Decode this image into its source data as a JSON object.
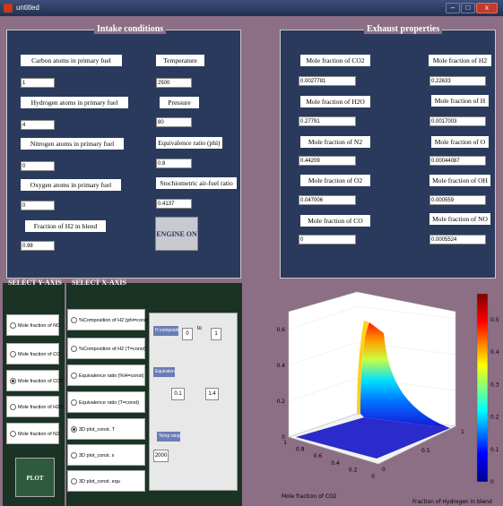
{
  "window": {
    "title": "untitled",
    "minimize": "–",
    "maximize": "□",
    "close": "x"
  },
  "intake": {
    "title": "Intake conditions",
    "fields": [
      {
        "label": "Carbon atoms in primary fuel",
        "value": "1"
      },
      {
        "label": "Hydrogen atoms in primary fuel",
        "value": "4"
      },
      {
        "label": "Nitrogen atoms in primary fuel",
        "value": "0"
      },
      {
        "label": "Oxygen atoms in primary fuel",
        "value": "0"
      },
      {
        "label": "Fraction of H2 in blend",
        "value": "0.98"
      }
    ],
    "right_fields": [
      {
        "label": "Temperature",
        "value": "2500"
      },
      {
        "label": "Pressure",
        "value": "80"
      },
      {
        "label": "Equivalence ratio (phi)",
        "value": "0.8"
      },
      {
        "label": "Stochiometric air-fuel ratio",
        "value": "0.4137"
      }
    ],
    "engine_button": "ENGINE ON"
  },
  "exhaust": {
    "title": "Exhaust properties",
    "left": [
      {
        "label": "Mole fraction of CO2",
        "value": "0.0027781"
      },
      {
        "label": "Mole fraction of H2O",
        "value": "0.27791"
      },
      {
        "label": "Mole fraction of N2",
        "value": "0.44209"
      },
      {
        "label": "Mole fraction of O2",
        "value": "0.047006"
      },
      {
        "label": "Mole fraction of CO",
        "value": "0"
      }
    ],
    "right": [
      {
        "label": "Mole fraction of H2",
        "value": "0.22633"
      },
      {
        "label": "Mole fraction of H",
        "value": "0.0017003"
      },
      {
        "label": "Mole fraction of O",
        "value": "0.00044087"
      },
      {
        "label": "Mole fraction of OH",
        "value": "0.000559"
      },
      {
        "label": "Mole fraction of NO",
        "value": "0.0005524"
      }
    ]
  },
  "yaxis": {
    "title": "SELECT Y-AXIS",
    "options": [
      {
        "label": "Mole fraction of NO",
        "selected": false
      },
      {
        "label": "Mole fraction of CO",
        "selected": false
      },
      {
        "label": "Mole fraction of CO2",
        "selected": true
      },
      {
        "label": "Mole fraction of H2O",
        "selected": false
      },
      {
        "label": "Mole fraction of N2",
        "selected": false
      }
    ],
    "plot_button": "PLOT GRAPH"
  },
  "xaxis": {
    "title": "SELECT X-AXIS",
    "options": [
      {
        "label": "%Composition of H2 (phi=const)",
        "selected": false
      },
      {
        "label": "%Composition of H2 (T=const)",
        "selected": false
      },
      {
        "label": "Equivalence ratio (%H=const)",
        "selected": false
      },
      {
        "label": "Equivalence ratio (T=const)",
        "selected": false
      },
      {
        "label": "3D plot_const. T",
        "selected": true
      },
      {
        "label": "3D plot_const. x",
        "selected": false
      },
      {
        "label": "3D plot_const. equ",
        "selected": false
      }
    ]
  },
  "ranges": {
    "h_composition_label": "H composition",
    "h_from": "0",
    "to_label": "to",
    "h_to": "1",
    "equivalence_label": "Equivalence",
    "eq_from": "0.1",
    "eq_to": "1.4",
    "temp_label": "Temp range",
    "temp_value": "2000"
  },
  "chart_data": {
    "type": "surface",
    "xlabel": "Fraction of Hydrogen in blend",
    "ylabel": "Mole fraction of CO2",
    "zticks": [
      "0",
      "0.2",
      "0.4",
      "0.6"
    ],
    "xticks": [
      "0",
      "0.5",
      "1"
    ],
    "yticks": [
      "0",
      "0.2",
      "0.4",
      "0.6",
      "0.8",
      "1"
    ],
    "zlim": [
      0,
      0.6
    ],
    "colorbar_ticks": [
      "0",
      "0.1",
      "0.2",
      "0.3",
      "0.4",
      "0.5"
    ],
    "colorbar_range": [
      0,
      0.58
    ],
    "peak_value": 0.55,
    "colormap": [
      "#00008f",
      "#0000ff",
      "#00ffff",
      "#ffff00",
      "#ff0000",
      "#800000"
    ]
  }
}
